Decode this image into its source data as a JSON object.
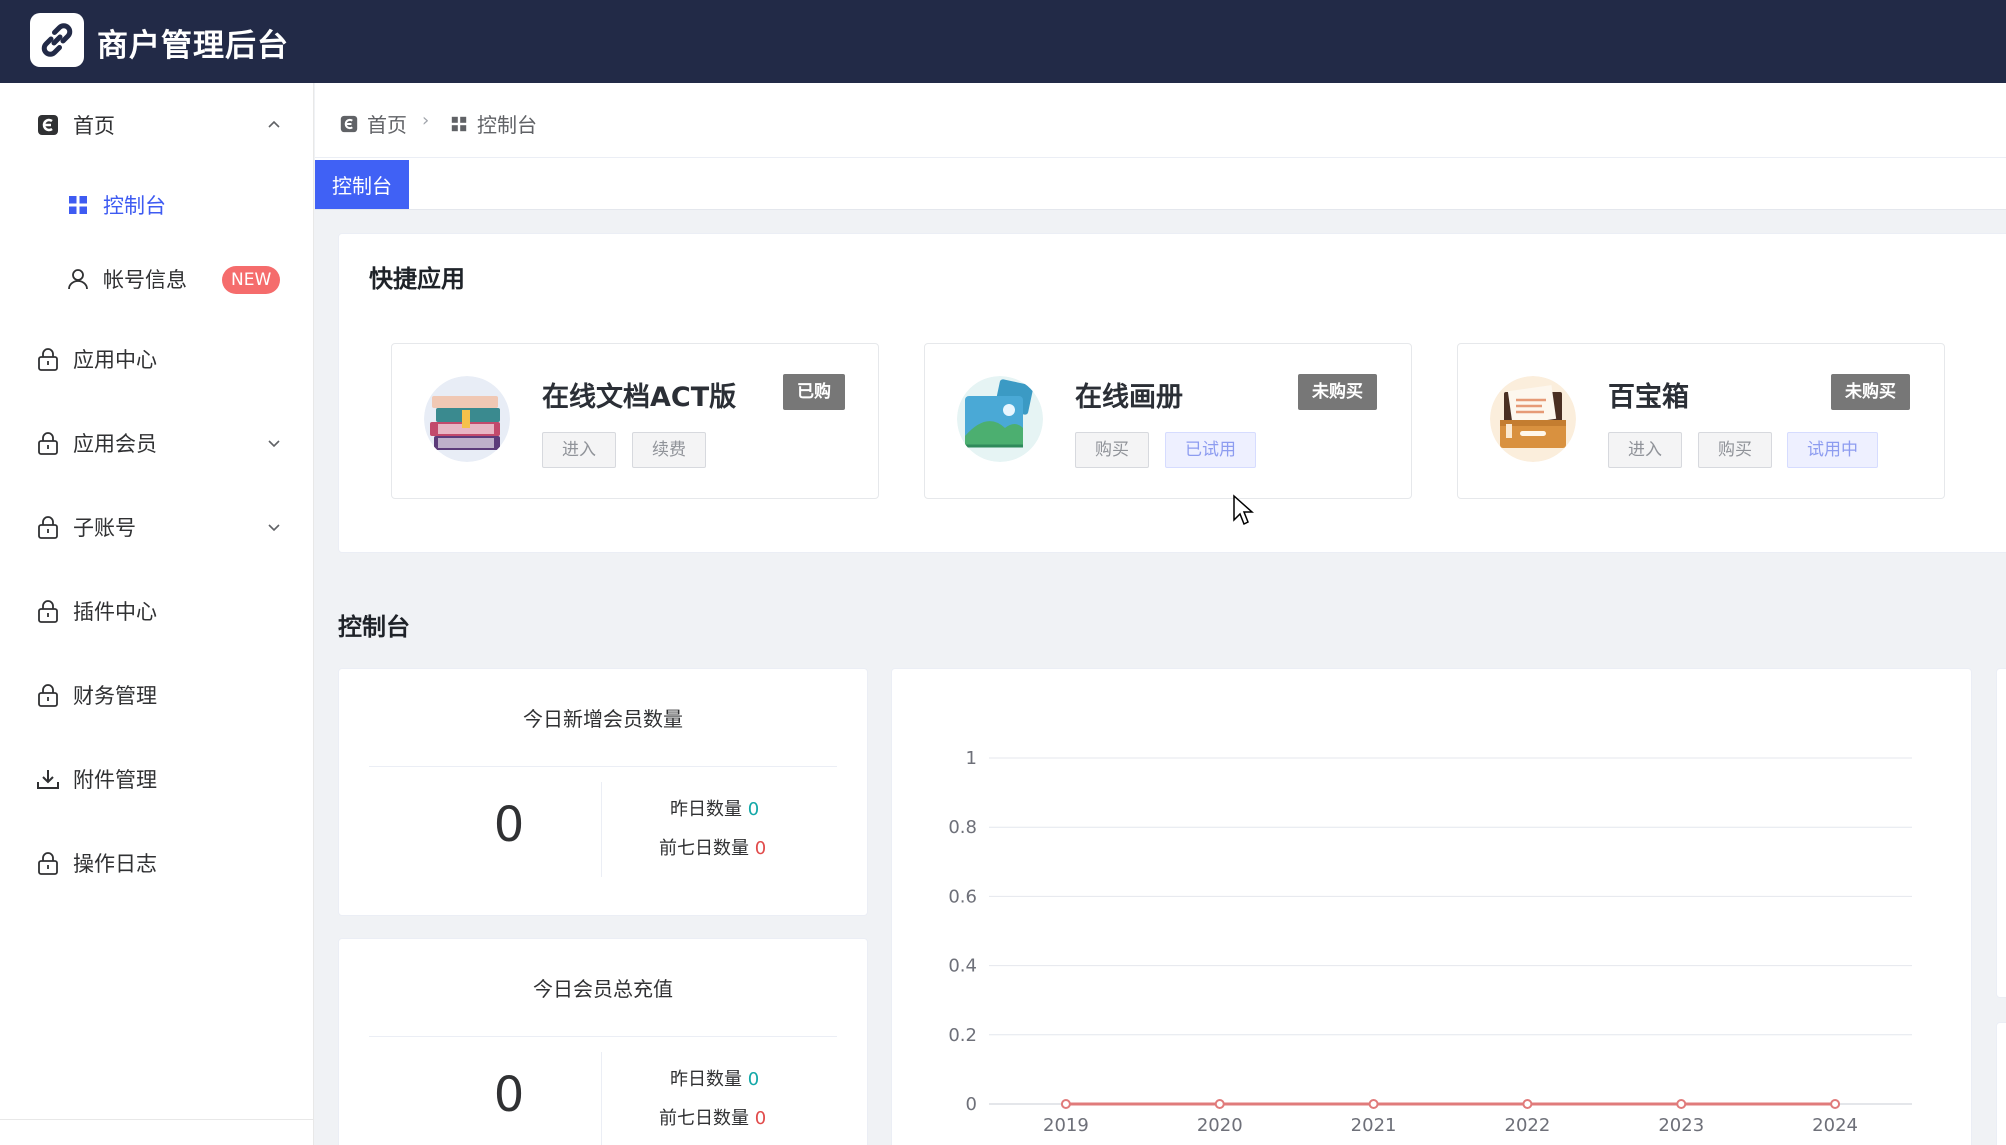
{
  "header": {
    "title": "商户管理后台"
  },
  "sidebar": {
    "items": [
      {
        "label": "首页",
        "icon": "home-icon",
        "expanded": true
      },
      {
        "label": "控制台",
        "icon": "dashboard-grid-icon",
        "active": true
      },
      {
        "label": "帐号信息",
        "icon": "user-icon",
        "badge": "NEW"
      },
      {
        "label": "应用中心",
        "icon": "lock-icon"
      },
      {
        "label": "应用会员",
        "icon": "lock-icon",
        "expandable": true
      },
      {
        "label": "子账号",
        "icon": "lock-icon",
        "expandable": true
      },
      {
        "label": "插件中心",
        "icon": "lock-icon"
      },
      {
        "label": "财务管理",
        "icon": "lock-icon"
      },
      {
        "label": "附件管理",
        "icon": "download-icon"
      },
      {
        "label": "操作日志",
        "icon": "lock-icon"
      }
    ]
  },
  "breadcrumb": {
    "home": "首页",
    "current": "控制台"
  },
  "tabs": [
    {
      "label": "控制台",
      "active": true
    }
  ],
  "quick_apps": {
    "title": "快捷应用",
    "apps": [
      {
        "name": "在线文档ACT版",
        "status": "已购",
        "buttons": [
          "进入",
          "续费"
        ],
        "icon": "books-icon"
      },
      {
        "name": "在线画册",
        "status": "未购买",
        "buttons": [
          "购买",
          "已试用"
        ],
        "icon": "photo-album-icon"
      },
      {
        "name": "百宝箱",
        "status": "未购买",
        "buttons": [
          "进入",
          "购买",
          "试用中"
        ],
        "icon": "treasure-box-icon"
      }
    ]
  },
  "dashboard": {
    "title": "控制台",
    "stats": [
      {
        "title": "今日新增会员数量",
        "value": "0",
        "yesterday_label": "昨日数量",
        "yesterday_value": "0",
        "week_label": "前七日数量",
        "week_value": "0"
      },
      {
        "title": "今日会员总充值",
        "value": "0",
        "yesterday_label": "昨日数量",
        "yesterday_value": "0",
        "week_label": "前七日数量",
        "week_value": "0"
      }
    ]
  },
  "colors": {
    "header_bg": "#222a47",
    "accent": "#4061f5",
    "badge_red": "#f56c6c",
    "line": "#e07b7b"
  },
  "chart_data": {
    "type": "line",
    "x": [
      "2019",
      "2020",
      "2021",
      "2022",
      "2023",
      "2024"
    ],
    "series": [
      {
        "values": [
          0,
          0,
          0,
          0,
          0,
          0
        ]
      }
    ],
    "y_ticks": [
      "0",
      "0.2",
      "0.4",
      "0.6",
      "0.8",
      "1"
    ],
    "ylim": [
      0,
      1
    ],
    "grid": true
  }
}
